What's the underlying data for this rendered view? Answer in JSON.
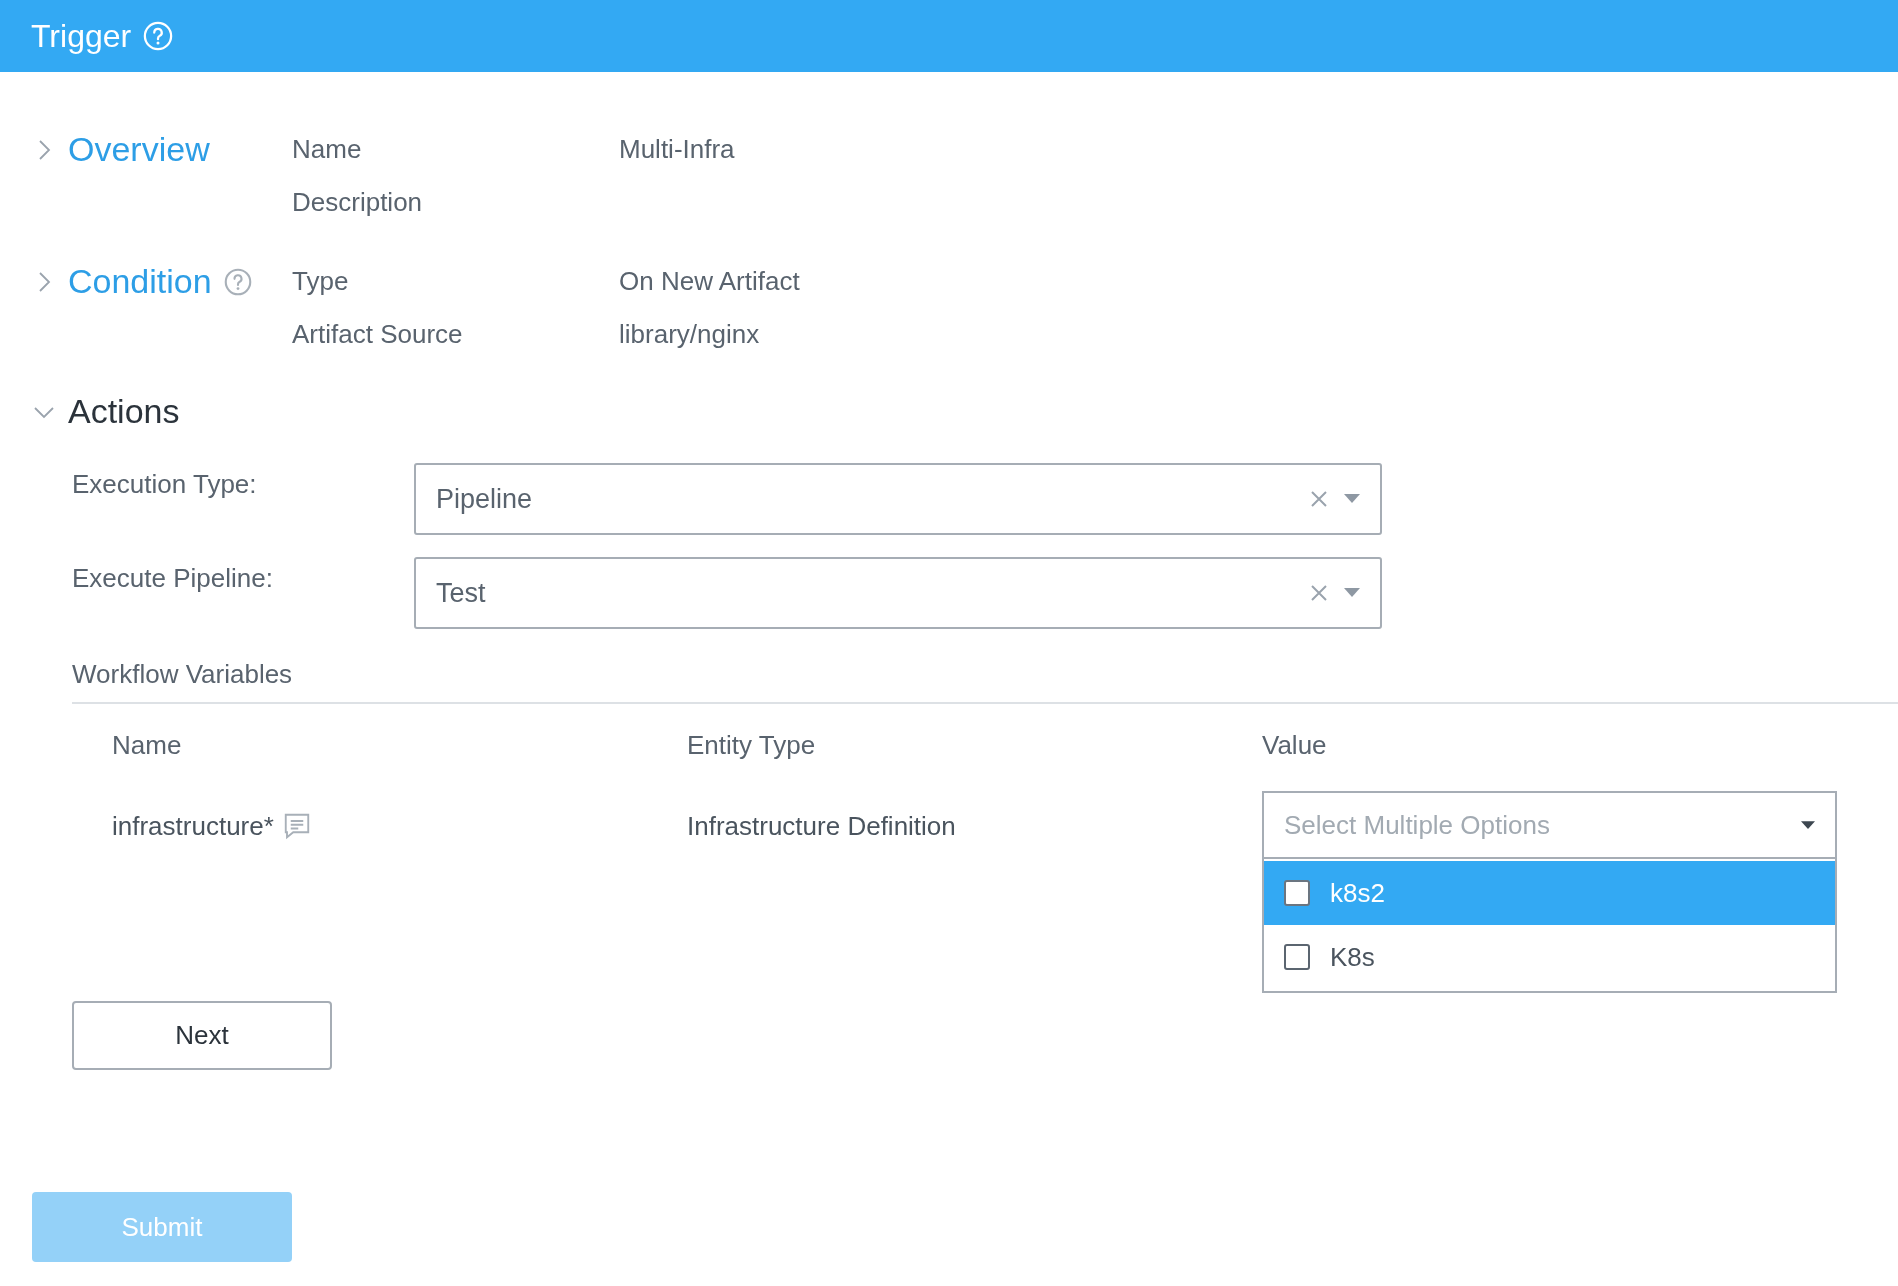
{
  "header": {
    "title": "Trigger"
  },
  "sections": [
    {
      "title": "Overview",
      "expanded": false,
      "help": false,
      "fields": [
        {
          "label": "Name",
          "value": "Multi-Infra"
        },
        {
          "label": "Description"
        }
      ]
    },
    {
      "title": "Condition",
      "expanded": false,
      "help": true,
      "fields": [
        {
          "label": "Type",
          "value": "On New Artifact"
        },
        {
          "label": "Artifact Source",
          "value": "library/nginx"
        }
      ]
    }
  ],
  "actions": {
    "title": "Actions",
    "expanded": true,
    "fields": [
      {
        "label": "Execution Type:",
        "value": "Pipeline"
      },
      {
        "label": "Execute Pipeline:",
        "value": "Test"
      }
    ],
    "workflow_variables": {
      "title": "Workflow Variables",
      "columns": [
        "Name",
        "Entity Type",
        "Value"
      ],
      "rows": [
        {
          "name": "infrastructure*",
          "entity_type": "Infrastructure Definition",
          "value": {
            "placeholder": "Select Multiple Options",
            "expanded": true,
            "options": [
              {
                "label": "k8s2",
                "selected": true,
                "checked": false
              },
              {
                "label": "K8s",
                "selected": false,
                "checked": false
              }
            ]
          }
        }
      ]
    },
    "next_button": "Next"
  },
  "submit": {
    "label": "Submit",
    "disabled": true
  }
}
